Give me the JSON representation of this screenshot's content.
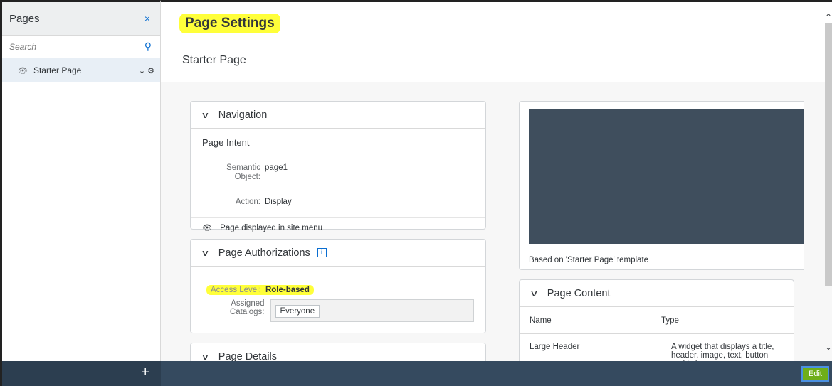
{
  "sidebar": {
    "title": "Pages",
    "close_glyph": "×",
    "search_placeholder": "Search",
    "search_icon": "⚲",
    "items": [
      {
        "label": "Starter Page",
        "icon": "eye-icon",
        "actions": "⌄ ⚙"
      }
    ]
  },
  "main": {
    "page_title": "Page Settings",
    "sub_title": "Starter Page",
    "navigation": {
      "header": "Navigation",
      "intent_label": "Page Intent",
      "semantic_object_label": "Semantic Object:",
      "semantic_object_value": "page1",
      "action_label": "Action:",
      "action_value": "Display",
      "site_menu_text": "Page displayed in site menu"
    },
    "authorizations": {
      "header": "Page Authorizations",
      "info_glyph": "i",
      "access_level_label": "Access Level:",
      "access_level_value": "Role-based",
      "catalogs_label": "Assigned Catalogs:",
      "catalogs": [
        "Everyone"
      ]
    },
    "details": {
      "header": "Page Details"
    },
    "preview": {
      "caption": "Based on 'Starter Page' template"
    },
    "content": {
      "header": "Page Content",
      "col_name": "Name",
      "col_type": "Type",
      "rows": [
        {
          "name": "Large Header",
          "type": "A widget that displays a title, header, image, text, button and link"
        }
      ]
    }
  },
  "bottombar": {
    "add_glyph": "+",
    "edit_label": "Edit"
  },
  "colors": {
    "highlight": "#ffff3a",
    "accent": "#0a6ed1",
    "shell": "#354a5f",
    "preview_bg": "#3f4e5d",
    "edit_button": "#6fae1a"
  }
}
